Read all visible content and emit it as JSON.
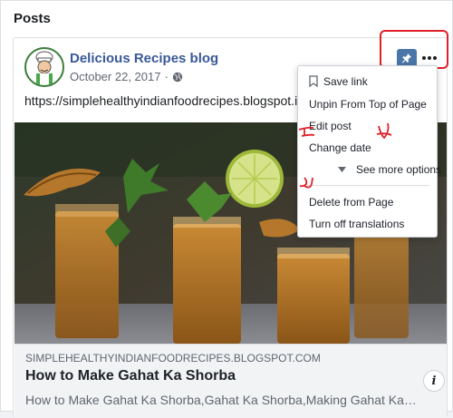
{
  "section": {
    "title": "Posts"
  },
  "post": {
    "page_name": "Delicious Recipes blog",
    "date": "October 22, 2017",
    "link_text": "https://simplehealthyindianfoodrecipes.blogspot.i"
  },
  "menu": {
    "items": [
      "Save link",
      "Unpin From Top of Page",
      "Edit post",
      "Change date",
      "See more options",
      "Delete from Page",
      "Turn off translations"
    ]
  },
  "preview": {
    "domain": "SIMPLEHEALTHYINDIANFOODRECIPES.BLOGSPOT.COM",
    "title": "How to Make Gahat Ka Shorba",
    "description": "How to Make Gahat Ka Shorba,Gahat Ka Shorba,Making Gahat Ka…",
    "info_label": "i"
  },
  "colors": {
    "link_blue": "#385898",
    "pin_blue": "#4a76a8",
    "annotation_red": "#e0202a"
  }
}
